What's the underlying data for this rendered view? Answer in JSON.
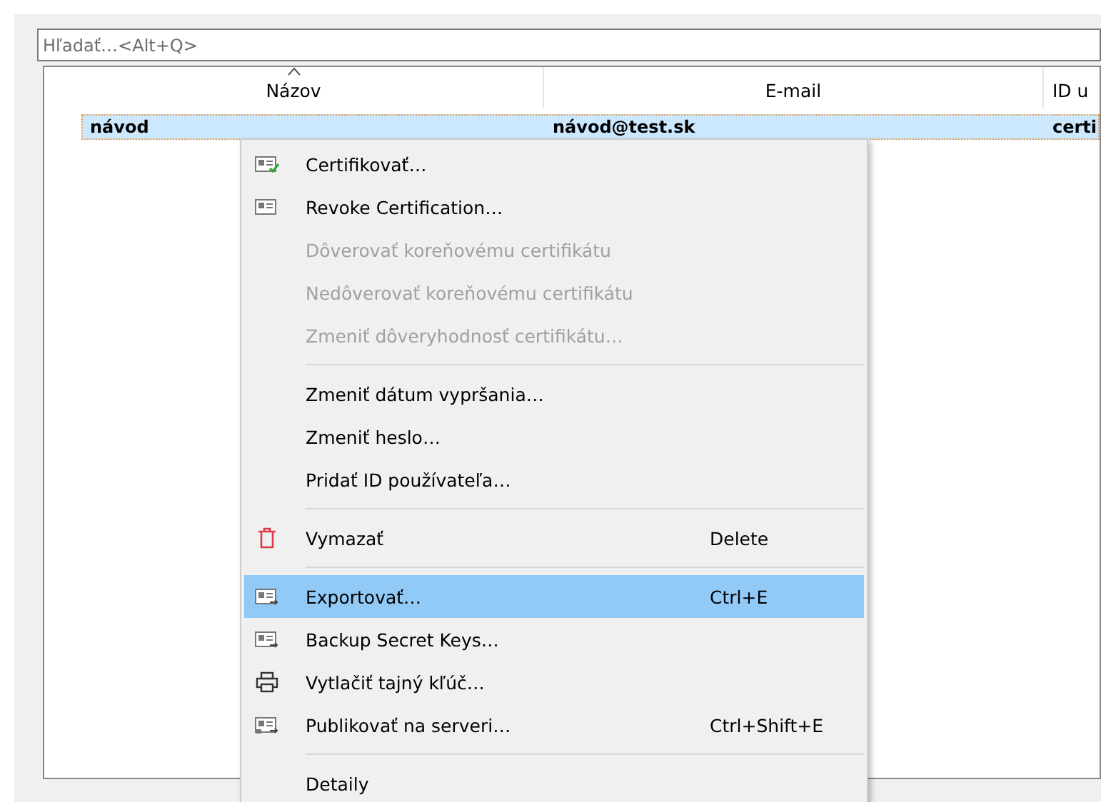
{
  "search": {
    "placeholder": "Hľadať…<Alt+Q>"
  },
  "table": {
    "columns": [
      {
        "label": "Názov",
        "sorted": true
      },
      {
        "label": "E-mail",
        "sorted": false
      },
      {
        "label": "ID u",
        "sorted": false
      }
    ],
    "rows": [
      {
        "selected": true,
        "cells": [
          "návod",
          "návod@test.sk",
          "certi"
        ]
      }
    ]
  },
  "context_menu": {
    "items": [
      {
        "kind": "certify",
        "label": "Certifikovať…",
        "disabled": false,
        "selected": false
      },
      {
        "kind": "revoke",
        "label": "Revoke Certification…",
        "disabled": false,
        "selected": false
      },
      {
        "kind": "item",
        "label": "Dôverovať koreňovému certifikátu",
        "disabled": true,
        "selected": false
      },
      {
        "kind": "item",
        "label": "Nedôverovať koreňovému certifikátu",
        "disabled": true,
        "selected": false
      },
      {
        "kind": "item",
        "label": "Zmeniť dôveryhodnosť certifikátu…",
        "disabled": true,
        "selected": false
      },
      {
        "kind": "separator"
      },
      {
        "kind": "item",
        "label": "Zmeniť dátum vypršania…",
        "disabled": false,
        "selected": false
      },
      {
        "kind": "item",
        "label": "Zmeniť heslo…",
        "disabled": false,
        "selected": false
      },
      {
        "kind": "item",
        "label": "Pridať ID používateľa…",
        "disabled": false,
        "selected": false
      },
      {
        "kind": "separator"
      },
      {
        "kind": "delete",
        "label": "Vymazať",
        "shortcut": "Delete",
        "disabled": false,
        "selected": false
      },
      {
        "kind": "separator"
      },
      {
        "kind": "export",
        "label": "Exportovať…",
        "shortcut": "Ctrl+E",
        "disabled": false,
        "selected": true
      },
      {
        "kind": "export",
        "label": "Backup Secret Keys…",
        "disabled": false,
        "selected": false
      },
      {
        "kind": "print",
        "label": "Vytlačiť tajný kľúč…",
        "disabled": false,
        "selected": false
      },
      {
        "kind": "publish",
        "label": "Publikovať na serveri…",
        "shortcut": "Ctrl+Shift+E",
        "disabled": false,
        "selected": false
      },
      {
        "kind": "separator"
      },
      {
        "kind": "item",
        "label": "Detaily",
        "disabled": false,
        "selected": false
      }
    ]
  }
}
